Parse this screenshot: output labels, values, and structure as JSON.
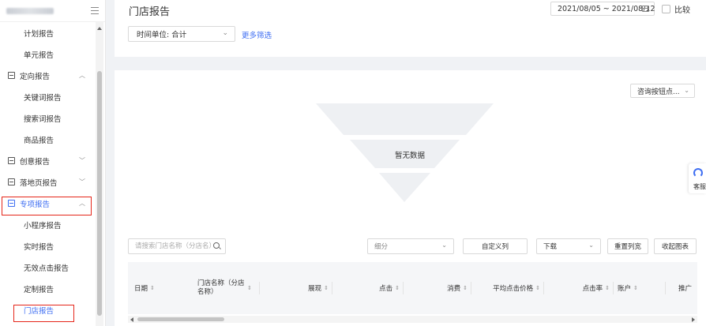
{
  "sidebar": {
    "items": [
      {
        "label": "计划报告",
        "kind": "sub"
      },
      {
        "label": "单元报告",
        "kind": "sub"
      },
      {
        "label": "定向报告",
        "kind": "group",
        "chevron": "chevron-up"
      },
      {
        "label": "关键词报告",
        "kind": "sub"
      },
      {
        "label": "搜索词报告",
        "kind": "sub"
      },
      {
        "label": "商品报告",
        "kind": "sub"
      },
      {
        "label": "创意报告",
        "kind": "group",
        "chevron": "chevron-down"
      },
      {
        "label": "落地页报告",
        "kind": "group",
        "chevron": "chevron-down"
      },
      {
        "label": "专项报告",
        "kind": "group",
        "chevron": "chevron-up",
        "active": true
      },
      {
        "label": "小程序报告",
        "kind": "sub"
      },
      {
        "label": "实时报告",
        "kind": "sub"
      },
      {
        "label": "无效点击报告",
        "kind": "sub"
      },
      {
        "label": "定制报告",
        "kind": "sub"
      },
      {
        "label": "门店报告",
        "kind": "sub",
        "selected": true
      }
    ]
  },
  "header": {
    "title": "门店报告",
    "date_range": "2021/08/05 ~ 2021/08/12",
    "compare_label": "比较",
    "time_unit": "时间单位: 合计",
    "more_filters": "更多筛选"
  },
  "content": {
    "chart_select": "咨询按钮点...",
    "empty_text": "暂无数据",
    "search_placeholder": "请搜索门店名称（分店名）",
    "segment_select": "细分",
    "custom_columns": "自定义列",
    "download": "下载",
    "reset_columns": "重置列宽",
    "collapse_chart": "收起图表"
  },
  "table": {
    "columns": [
      "日期",
      "门店名称（分店名称）",
      "展现",
      "点击",
      "消费",
      "平均点击价格",
      "点击率",
      "账户",
      "推广"
    ]
  },
  "customer_service": {
    "label": "客服"
  },
  "colors": {
    "accent": "#3d6df2",
    "highlight_border": "#e5261a"
  }
}
